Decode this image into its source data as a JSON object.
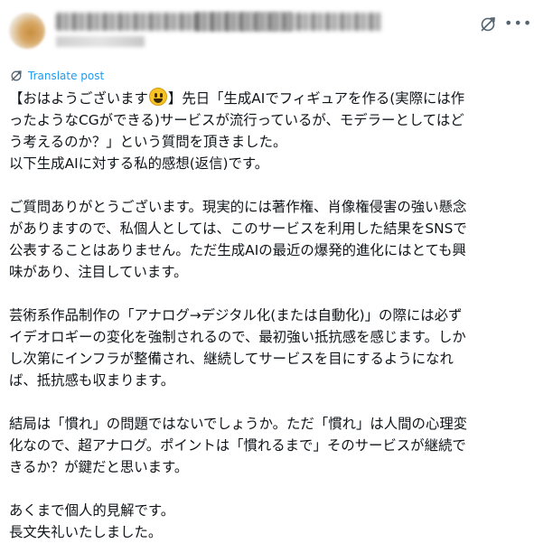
{
  "post": {
    "translate_label": "Translate post",
    "lines": [
      [
        "【おはようございます",
        "】先日「生成AIでフィギュアを作る(実際には作"
      ],
      "ったようなCGができる)サービスが流行っているが、モデラーとしてはど",
      "う考えるのか？」という質問を頂きました。",
      "以下生成AIに対する私的感想(返信)です。",
      "",
      "ご質問ありがとうございます。現実的には著作権、肖像権侵害の強い懸念",
      "がありますので、私個人としては、このサービスを利用した結果をSNSで",
      "公表することはありません。ただ生成AIの最近の爆発的進化にはとても興",
      "味があり、注目しています。",
      "",
      "芸術系作品制作の「アナログ→デジタル化(または自動化)」の際には必ず",
      "イデオロギーの変化を強制されるので、最初強い抵抗感を感じます。しか",
      "し次第にインフラが整備され、継続してサービスを目にするようになれ",
      "ば、抵抗感も収まります。",
      "",
      "結局は「慣れ」の問題ではないでしょうか。ただ「慣れ」は人間の心理変",
      "化なので、超アナログ。ポイントは「慣れるまで」そのサービスが継続で",
      "きるか？が鍵だと思います。",
      "",
      "あくまで個人的見解です。",
      "長文失礼いたしました。"
    ]
  },
  "icons": {
    "avatar": "avatar-blurred",
    "translate": "translate-icon",
    "more": "more-icon",
    "emoji": "grinning-face-emoji"
  },
  "colors": {
    "accent": "#1d9bf0",
    "text": "#0f1419",
    "muted": "#536471"
  }
}
